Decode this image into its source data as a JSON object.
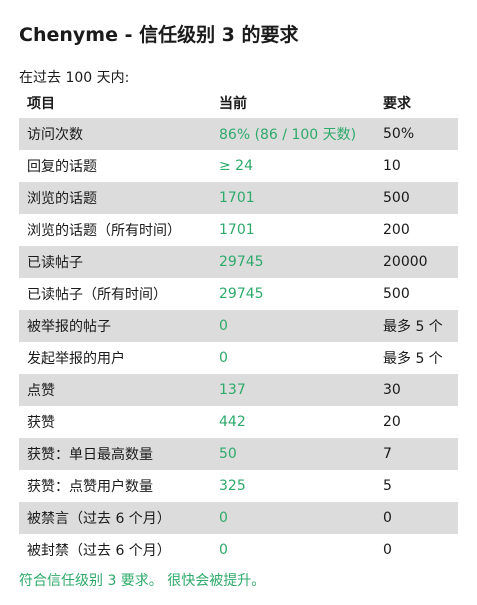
{
  "title": "Chenyme - 信任级别 3 的要求",
  "subtitle": "在过去 100 天内:",
  "headers": {
    "item": "项目",
    "current": "当前",
    "required": "要求"
  },
  "rows": [
    {
      "item": "访问次数",
      "current": "86% (86 / 100 天数)",
      "required": "50%"
    },
    {
      "item": "回复的话题",
      "current": "≥ 24",
      "required": "10"
    },
    {
      "item": "浏览的话题",
      "current": "1701",
      "required": "500"
    },
    {
      "item": "浏览的话题（所有时间）",
      "current": "1701",
      "required": "200"
    },
    {
      "item": "已读帖子",
      "current": "29745",
      "required": "20000"
    },
    {
      "item": "已读帖子（所有时间）",
      "current": "29745",
      "required": "500"
    },
    {
      "item": "被举报的帖子",
      "current": "0",
      "required": "最多 5 个"
    },
    {
      "item": "发起举报的用户",
      "current": "0",
      "required": "最多 5 个"
    },
    {
      "item": "点赞",
      "current": "137",
      "required": "30"
    },
    {
      "item": "获赞",
      "current": "442",
      "required": "20"
    },
    {
      "item": "获赞：单日最高数量",
      "current": "50",
      "required": "7"
    },
    {
      "item": "获赞：点赞用户数量",
      "current": "325",
      "required": "5"
    },
    {
      "item": "被禁言（过去 6 个月）",
      "current": "0",
      "required": "0"
    },
    {
      "item": "被封禁（过去 6 个月）",
      "current": "0",
      "required": "0"
    }
  ],
  "footer": "符合信任级别 3 要求。 很快会被提升。",
  "colors": {
    "met": "#2eaa6b",
    "stripe": "#dcdcdc"
  }
}
